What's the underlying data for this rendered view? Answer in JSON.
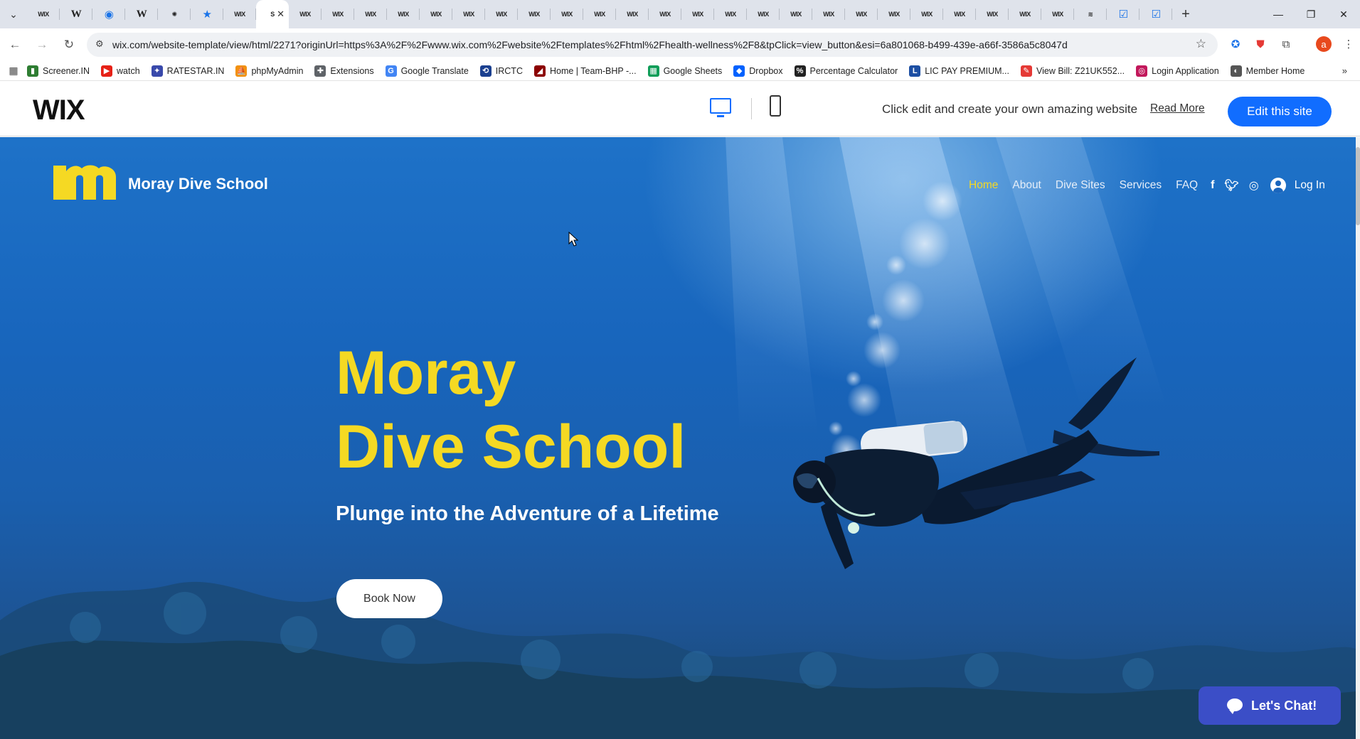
{
  "browser": {
    "tabs": [
      {
        "icon": "wix",
        "label": "WIX"
      },
      {
        "icon": "wikipedia",
        "label": "W"
      },
      {
        "icon": "globe",
        "label": "◉"
      },
      {
        "icon": "wikipedia",
        "label": "W"
      },
      {
        "icon": "chatgpt",
        "label": "✺"
      },
      {
        "icon": "star",
        "label": "★"
      },
      {
        "icon": "wix",
        "label": "WIX"
      },
      {
        "icon": "wix-active",
        "label": "S",
        "active": true
      },
      {
        "icon": "wix",
        "label": "WIX"
      },
      {
        "icon": "wix",
        "label": "WIX"
      },
      {
        "icon": "wix",
        "label": "WIX"
      },
      {
        "icon": "wix",
        "label": "WIX"
      },
      {
        "icon": "wix",
        "label": "WIX"
      },
      {
        "icon": "wix",
        "label": "WIX"
      },
      {
        "icon": "wix",
        "label": "WIX"
      },
      {
        "icon": "wix",
        "label": "WIX"
      },
      {
        "icon": "wix",
        "label": "WIX"
      },
      {
        "icon": "wix",
        "label": "WIX"
      },
      {
        "icon": "wix",
        "label": "WIX"
      },
      {
        "icon": "wix",
        "label": "WIX"
      },
      {
        "icon": "wix",
        "label": "WIX"
      },
      {
        "icon": "wix",
        "label": "WIX"
      },
      {
        "icon": "wix",
        "label": "WIX"
      },
      {
        "icon": "wix",
        "label": "WIX"
      },
      {
        "icon": "wix",
        "label": "WIX"
      },
      {
        "icon": "wix",
        "label": "WIX"
      },
      {
        "icon": "wix",
        "label": "WIX"
      },
      {
        "icon": "wix",
        "label": "WIX"
      },
      {
        "icon": "wix",
        "label": "WIX"
      },
      {
        "icon": "wix",
        "label": "WIX"
      },
      {
        "icon": "wix",
        "label": "WIX"
      },
      {
        "icon": "wix",
        "label": "WIX"
      },
      {
        "icon": "feather",
        "label": "≋"
      },
      {
        "icon": "bluesky",
        "label": "☑"
      },
      {
        "icon": "bluesky",
        "label": "☑"
      }
    ],
    "url": "wix.com/website-template/view/html/2271?originUrl=https%3A%2F%2Fwww.wix.com%2Fwebsite%2Ftemplates%2Fhtml%2Fhealth-wellness%2F8&tpClick=view_button&esi=6a801068-b499-439e-a66f-3586a5c8047d",
    "profile_initial": "a",
    "bookmarks": [
      {
        "label": "Screener.IN",
        "color": "#2e7d32",
        "glyph": "▮"
      },
      {
        "label": "watch",
        "color": "#e62117",
        "glyph": "▶"
      },
      {
        "label": "RATESTAR.IN",
        "color": "#3949ab",
        "glyph": "✦"
      },
      {
        "label": "phpMyAdmin",
        "color": "#f29111",
        "glyph": "⛵"
      },
      {
        "label": "Extensions",
        "color": "#5f6368",
        "glyph": "✚"
      },
      {
        "label": "Google Translate",
        "color": "#4285f4",
        "glyph": "G"
      },
      {
        "label": "IRCTC",
        "color": "#1a3f8f",
        "glyph": "⟲"
      },
      {
        "label": "Home | Team-BHP -...",
        "color": "#8b0000",
        "glyph": "◢"
      },
      {
        "label": "Google Sheets",
        "color": "#0f9d58",
        "glyph": "▦"
      },
      {
        "label": "Dropbox",
        "color": "#0061fe",
        "glyph": "◆"
      },
      {
        "label": "Percentage Calculator",
        "color": "#222222",
        "glyph": "%"
      },
      {
        "label": "LIC PAY PREMIUM...",
        "color": "#1d4fa3",
        "glyph": "L"
      },
      {
        "label": "View Bill: Z21UK552...",
        "color": "#e53935",
        "glyph": "✎"
      },
      {
        "label": "Login Application",
        "color": "#c2185b",
        "glyph": "◎"
      },
      {
        "label": "Member Home",
        "color": "#555555",
        "glyph": "◐"
      }
    ]
  },
  "wixbar": {
    "logo": "WIX",
    "message": "Click edit and create your own amazing website",
    "read_more": "Read More",
    "edit_button": "Edit this site",
    "accent": "#116dff"
  },
  "site": {
    "name": "Moray Dive School",
    "logo_letter": "m",
    "nav": [
      "Home",
      "About",
      "Dive Sites",
      "Services",
      "FAQ"
    ],
    "active_nav": "Home",
    "social": [
      "facebook",
      "twitter",
      "instagram"
    ],
    "login": "Log In",
    "hero_title_line1": "Moray",
    "hero_title_line2": "Dive School",
    "hero_subtitle": "Plunge into the Adventure of a Lifetime",
    "cta": "Book Now",
    "chat": "Let's Chat!",
    "accent": "#f5d923"
  }
}
